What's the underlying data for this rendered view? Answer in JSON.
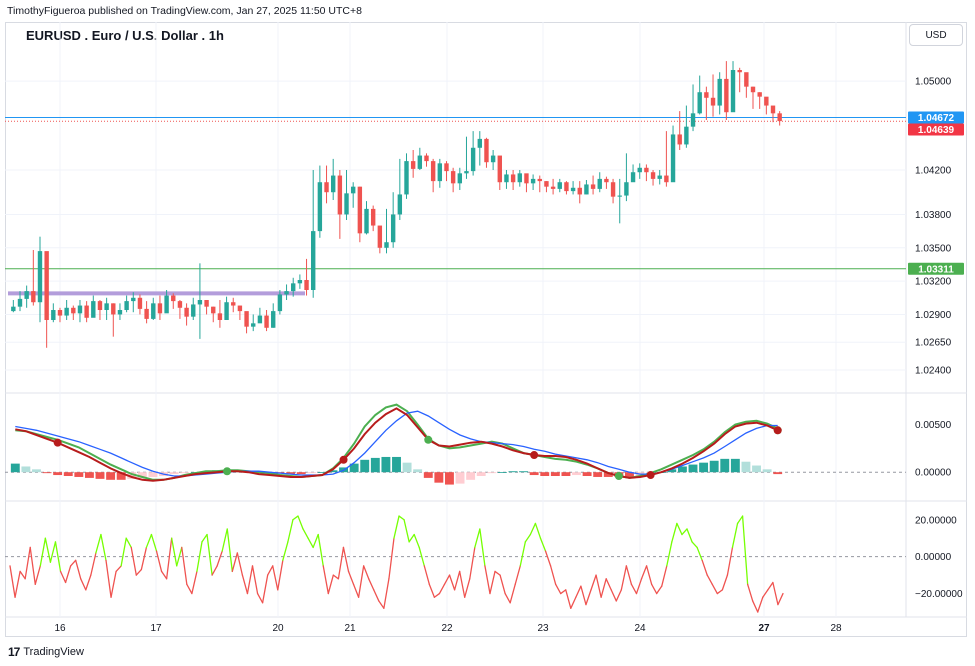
{
  "header": {
    "published": "TimothyFigueroa published on TradingView.com, Jan 27, 2025 11:50 UTC+8"
  },
  "chart_title": "EURUSD . Euro / U.S. Dollar . 1h",
  "currency_button": "USD",
  "footer": {
    "brand": "TradingView"
  },
  "colors": {
    "up": "#26a69a",
    "down": "#ef5350",
    "blue": "#2962ff",
    "green_line": "#4caf50",
    "dark_red": "#b71c1c",
    "purple": "#b39ddb"
  },
  "chart_data": [
    {
      "type": "candlestick",
      "title": "EURUSD . Euro / U.S. Dollar . 1h",
      "x_ticks": [
        "16",
        "17",
        "20",
        "21",
        "22",
        "23",
        "24",
        "27",
        "28"
      ],
      "y_ticks": [
        "1.05000",
        "1.04200",
        "1.03800",
        "1.03500",
        "1.03200",
        "1.02900",
        "1.02650",
        "1.02400"
      ],
      "ylim": [
        1.0222,
        1.0528
      ],
      "price_labels": [
        {
          "value": 1.04672,
          "label": "1.04672",
          "color": "#2196f3"
        },
        {
          "value": 1.04639,
          "label": "1.04639",
          "color": "#f23645"
        },
        {
          "value": 1.03311,
          "label": "1.03311",
          "color": "#4caf50"
        }
      ],
      "horizontal_lines": [
        {
          "value": 1.04672,
          "color": "#2196f3",
          "style": "solid"
        },
        {
          "value": 1.04639,
          "color": "#ef5350",
          "style": "dotted"
        },
        {
          "value": 1.03311,
          "color": "#4caf50",
          "style": "solid"
        }
      ],
      "zones": [
        {
          "value": 1.0309,
          "color": "#b39ddb",
          "from": "15",
          "to": "20"
        }
      ],
      "closes": [
        1.0297,
        1.0304,
        1.0311,
        1.0301,
        1.0347,
        1.0285,
        1.0294,
        1.0289,
        1.0296,
        1.0291,
        1.0298,
        1.0287,
        1.0302,
        1.0294,
        1.03,
        1.029,
        1.0294,
        1.0302,
        1.0305,
        1.0295,
        1.0286,
        1.03,
        1.0291,
        1.0307,
        1.0302,
        1.0296,
        1.0288,
        1.0299,
        1.0303,
        1.0297,
        1.0291,
        1.0285,
        1.0301,
        1.0298,
        1.0293,
        1.0279,
        1.0282,
        1.0289,
        1.0278,
        1.0293,
        1.0308,
        1.0311,
        1.0318,
        1.0321,
        1.0312,
        1.0365,
        1.0409,
        1.04,
        1.0415,
        1.038,
        1.0399,
        1.0405,
        1.0363,
        1.0385,
        1.037,
        1.035,
        1.0355,
        1.038,
        1.0398,
        1.0428,
        1.0421,
        1.0433,
        1.0428,
        1.041,
        1.0426,
        1.0419,
        1.0408,
        1.0417,
        1.0419,
        1.044,
        1.0448,
        1.0427,
        1.0433,
        1.0409,
        1.0416,
        1.0409,
        1.0417,
        1.0408,
        1.0412,
        1.041,
        1.0405,
        1.0403,
        1.0409,
        1.0401,
        1.0404,
        1.0398,
        1.0407,
        1.0403,
        1.0412,
        1.0409,
        1.0396,
        1.0397,
        1.0409,
        1.0418,
        1.0422,
        1.0418,
        1.0412,
        1.0415,
        1.0409,
        1.0452,
        1.0443,
        1.0459,
        1.0471,
        1.049,
        1.0485,
        1.0478,
        1.0502,
        1.0472,
        1.051,
        1.0508,
        1.0495,
        1.049,
        1.0486,
        1.0478,
        1.0471,
        1.0464
      ],
      "highs": [
        1.0303,
        1.0311,
        1.0316,
        1.0348,
        1.036,
        1.0318,
        1.03,
        1.0296,
        1.0303,
        1.0298,
        1.0303,
        1.0302,
        1.0307,
        1.0303,
        1.0305,
        1.03,
        1.03,
        1.0307,
        1.031,
        1.0308,
        1.0302,
        1.0305,
        1.0307,
        1.0312,
        1.0309,
        1.0303,
        1.03,
        1.0305,
        1.0336,
        1.0303,
        1.0297,
        1.0303,
        1.0306,
        1.0305,
        1.0298,
        1.029,
        1.029,
        1.0296,
        1.0294,
        1.03,
        1.0312,
        1.0317,
        1.0323,
        1.0326,
        1.034,
        1.042,
        1.0424,
        1.0424,
        1.043,
        1.042,
        1.042,
        1.0409,
        1.0405,
        1.0392,
        1.0388,
        1.036,
        1.0385,
        1.04,
        1.043,
        1.0435,
        1.0438,
        1.044,
        1.0435,
        1.043,
        1.043,
        1.0428,
        1.0422,
        1.0422,
        1.045,
        1.0455,
        1.0455,
        1.0449,
        1.0438,
        1.0428,
        1.042,
        1.042,
        1.042,
        1.0414,
        1.0416,
        1.0415,
        1.041,
        1.0412,
        1.0412,
        1.041,
        1.041,
        1.041,
        1.0411,
        1.0415,
        1.0418,
        1.0414,
        1.0412,
        1.0412,
        1.0435,
        1.0425,
        1.0426,
        1.0425,
        1.042,
        1.042,
        1.0455,
        1.046,
        1.0473,
        1.0478,
        1.0497,
        1.0505,
        1.0495,
        1.0506,
        1.0508,
        1.0518,
        1.0518,
        1.0512,
        1.0502,
        1.0495,
        1.049,
        1.0483,
        1.0476,
        1.0473
      ],
      "lows": [
        1.0292,
        1.0293,
        1.0296,
        1.0298,
        1.0283,
        1.026,
        1.0283,
        1.0283,
        1.0285,
        1.0285,
        1.0283,
        1.0283,
        1.029,
        1.0285,
        1.0285,
        1.027,
        1.0285,
        1.0292,
        1.0292,
        1.029,
        1.0282,
        1.0285,
        1.0285,
        1.0293,
        1.0295,
        1.0286,
        1.028,
        1.0285,
        1.0268,
        1.029,
        1.0283,
        1.0278,
        1.0285,
        1.0292,
        1.0285,
        1.0273,
        1.0275,
        1.0284,
        1.0275,
        1.0278,
        1.029,
        1.0303,
        1.0306,
        1.0313,
        1.0307,
        1.0305,
        1.0359,
        1.039,
        1.0393,
        1.0358,
        1.0375,
        1.0386,
        1.0355,
        1.0362,
        1.0365,
        1.0345,
        1.0345,
        1.035,
        1.0375,
        1.0394,
        1.0413,
        1.042,
        1.0423,
        1.04,
        1.0404,
        1.041,
        1.04,
        1.0402,
        1.0412,
        1.0415,
        1.0424,
        1.0422,
        1.042,
        1.0402,
        1.0403,
        1.0402,
        1.0405,
        1.04,
        1.0402,
        1.04,
        1.04,
        1.0398,
        1.04,
        1.0398,
        1.0398,
        1.039,
        1.0398,
        1.0398,
        1.04,
        1.0403,
        1.039,
        1.0372,
        1.0392,
        1.041,
        1.0412,
        1.041,
        1.0406,
        1.0407,
        1.0405,
        1.0411,
        1.0438,
        1.044,
        1.0455,
        1.047,
        1.0465,
        1.0468,
        1.047,
        1.0465,
        1.049,
        1.049,
        1.0485,
        1.0475,
        1.0475,
        1.047,
        1.0463,
        1.046
      ]
    },
    {
      "type": "macd",
      "y_ticks": [
        "0.00500",
        "0.00000"
      ],
      "ylim": [
        -0.0025,
        0.008
      ],
      "series": [
        {
          "values": [
            0.0044,
            0.0043,
            0.004,
            0.0037,
            0.0034,
            0.003,
            0.0026,
            0.002,
            0.0014,
            0.0008,
            0.0003,
            -0.0002,
            -0.0005,
            -0.0008,
            -0.0008,
            -0.0006,
            -0.0003,
            -0.0001,
            0.0001,
            0.0001,
            0.0002,
            0.0002,
            0.0001,
            0.0,
            -0.0001,
            -0.0003,
            -0.0004,
            -0.0005,
            -0.0004,
            -0.0003,
            0.0004,
            0.0015,
            0.003,
            0.0048,
            0.006,
            0.0068,
            0.0071,
            0.0064,
            0.005,
            0.0035,
            0.0028,
            0.0025,
            0.0026,
            0.0028,
            0.003,
            0.0032,
            0.003,
            0.0025,
            0.002,
            0.0018,
            0.0016,
            0.0014,
            0.0013,
            0.0011,
            0.0008,
            0.0004,
            -0.0001,
            -0.0004,
            -0.0006,
            -0.0004,
            -0.0001,
            0.0003,
            0.0008,
            0.0013,
            0.0018,
            0.0024,
            0.0032,
            0.0042,
            0.005,
            0.0053,
            0.0054,
            0.0051,
            0.0046
          ]
        },
        {
          "values": [
            0.0048,
            0.0046,
            0.0044,
            0.0041,
            0.0038,
            0.0035,
            0.0032,
            0.0028,
            0.0024,
            0.002,
            0.0015,
            0.001,
            0.0005,
            0.0001,
            -0.0002,
            -0.0004,
            -0.0004,
            -0.0003,
            -0.0002,
            -0.0001,
            0.0,
            0.0001,
            0.0001,
            0.0001,
            0.0,
            -0.0001,
            -0.0002,
            -0.0003,
            -0.0003,
            -0.0003,
            -0.0002,
            0.0002,
            0.001,
            0.002,
            0.0032,
            0.0044,
            0.0054,
            0.0062,
            0.0064,
            0.0059,
            0.0052,
            0.0045,
            0.0039,
            0.0035,
            0.0032,
            0.0031,
            0.003,
            0.0029,
            0.0027,
            0.0024,
            0.0022,
            0.0019,
            0.0017,
            0.0015,
            0.0013,
            0.001,
            0.0006,
            0.0003,
            0.0,
            -0.0002,
            -0.0002,
            0.0,
            0.0003,
            0.0007,
            0.0011,
            0.0015,
            0.002,
            0.0027,
            0.0034,
            0.0041,
            0.0046,
            0.0049,
            0.0049
          ]
        },
        {
          "values": [
            0.0045,
            0.0043,
            0.0039,
            0.0035,
            0.0031,
            0.0026,
            0.0021,
            0.0016,
            0.001,
            0.0004,
            -0.0001,
            -0.0005,
            -0.0008,
            -0.0009,
            -0.0008,
            -0.0006,
            -0.0004,
            -0.0002,
            -0.0001,
            0.0,
            0.0001,
            0.0001,
            0.0,
            -0.0002,
            -0.0003,
            -0.0004,
            -0.0005,
            -0.0005,
            -0.0004,
            -0.0003,
            0.0003,
            0.0013,
            0.0025,
            0.004,
            0.0052,
            0.0061,
            0.0067,
            0.006,
            0.0047,
            0.0034,
            0.0028,
            0.0027,
            0.0029,
            0.0031,
            0.0032,
            0.003,
            0.0027,
            0.0023,
            0.002,
            0.0018,
            0.0017,
            0.0017,
            0.0016,
            0.0013,
            0.0009,
            0.0004,
            -0.0001,
            -0.0004,
            -0.0006,
            -0.0005,
            -0.0003,
            0.0,
            0.0004,
            0.0009,
            0.0015,
            0.0022,
            0.003,
            0.004,
            0.0048,
            0.0051,
            0.0052,
            0.0049,
            0.0044
          ]
        }
      ],
      "histogram": [
        0.0009,
        0.0006,
        0.0003,
        -0.0001,
        -0.0003,
        -0.0004,
        -0.0005,
        -0.0006,
        -0.0007,
        -0.0008,
        -0.0008,
        -0.0007,
        -0.0006,
        -0.0005,
        -0.0004,
        -0.0002,
        -0.0001,
        0.0,
        0.0001,
        0.0002,
        0.0002,
        0.0002,
        0.0001,
        0.0001,
        -0.0001,
        -0.0001,
        -0.0002,
        -0.0002,
        -0.0001,
        0.0,
        0.0002,
        0.0005,
        0.0009,
        0.0013,
        0.0015,
        0.0016,
        0.0016,
        0.001,
        0.0003,
        -0.0006,
        -0.0011,
        -0.0013,
        -0.0012,
        -0.0008,
        -0.0004,
        -0.0001,
        0.0,
        0.0001,
        0.0001,
        -0.0003,
        -0.0004,
        -0.0004,
        -0.0004,
        -0.0003,
        -0.0004,
        -0.0005,
        -0.0005,
        -0.0005,
        -0.0006,
        -0.0004,
        -0.0002,
        0.0,
        0.0003,
        0.0006,
        0.0008,
        0.001,
        0.0012,
        0.0014,
        0.0014,
        0.0011,
        0.0007,
        0.0003,
        -0.0002
      ],
      "signals": [
        {
          "i": 4,
          "dir": "down"
        },
        {
          "i": 20,
          "dir": "up"
        },
        {
          "i": 31,
          "dir": "down"
        },
        {
          "i": 39,
          "dir": "up"
        },
        {
          "i": 49,
          "dir": "down"
        },
        {
          "i": 57,
          "dir": "up"
        },
        {
          "i": 60,
          "dir": "down"
        },
        {
          "i": 80,
          "dir": "up"
        },
        {
          "i": 94,
          "dir": "down"
        }
      ]
    },
    {
      "type": "line",
      "y_ticks": [
        "20.00000",
        "0.00000",
        "−20.00000"
      ],
      "ylim": [
        -30,
        28
      ],
      "values": [
        -5,
        -22,
        -8,
        -12,
        5,
        -15,
        -5,
        10,
        -3,
        8,
        -8,
        -14,
        -5,
        -2,
        -12,
        -18,
        -10,
        2,
        12,
        -2,
        -22,
        -8,
        -5,
        10,
        5,
        -10,
        -7,
        5,
        12,
        3,
        -8,
        -12,
        10,
        -5,
        5,
        -15,
        -20,
        -8,
        8,
        12,
        -10,
        -5,
        3,
        15,
        -8,
        2,
        -10,
        -20,
        -5,
        -20,
        -25,
        -10,
        -5,
        -18,
        -2,
        8,
        20,
        22,
        15,
        10,
        5,
        12,
        -5,
        -20,
        -10,
        -12,
        5,
        -8,
        -15,
        -22,
        -5,
        -12,
        -18,
        -24,
        -28,
        -12,
        10,
        22,
        20,
        8,
        12,
        5,
        -5,
        -15,
        -22,
        -20,
        -15,
        -10,
        -18,
        -8,
        -22,
        -12,
        5,
        15,
        -5,
        -20,
        -8,
        -10,
        -20,
        -25,
        -15,
        -5,
        8,
        12,
        18,
        10,
        3,
        -5,
        -15,
        -20,
        -18,
        -28,
        -22,
        -16,
        -26,
        -18,
        -10,
        -22,
        -12,
        -18,
        -24,
        -18,
        -5,
        -15,
        -20,
        -12,
        -5,
        -15,
        -20,
        -16,
        -5,
        8,
        18,
        12,
        15,
        8,
        5,
        -2,
        -10,
        -15,
        -20,
        -18,
        -10,
        5,
        18,
        22,
        -15,
        -24,
        -30,
        -22,
        -18,
        -14,
        -26,
        -20
      ]
    }
  ]
}
